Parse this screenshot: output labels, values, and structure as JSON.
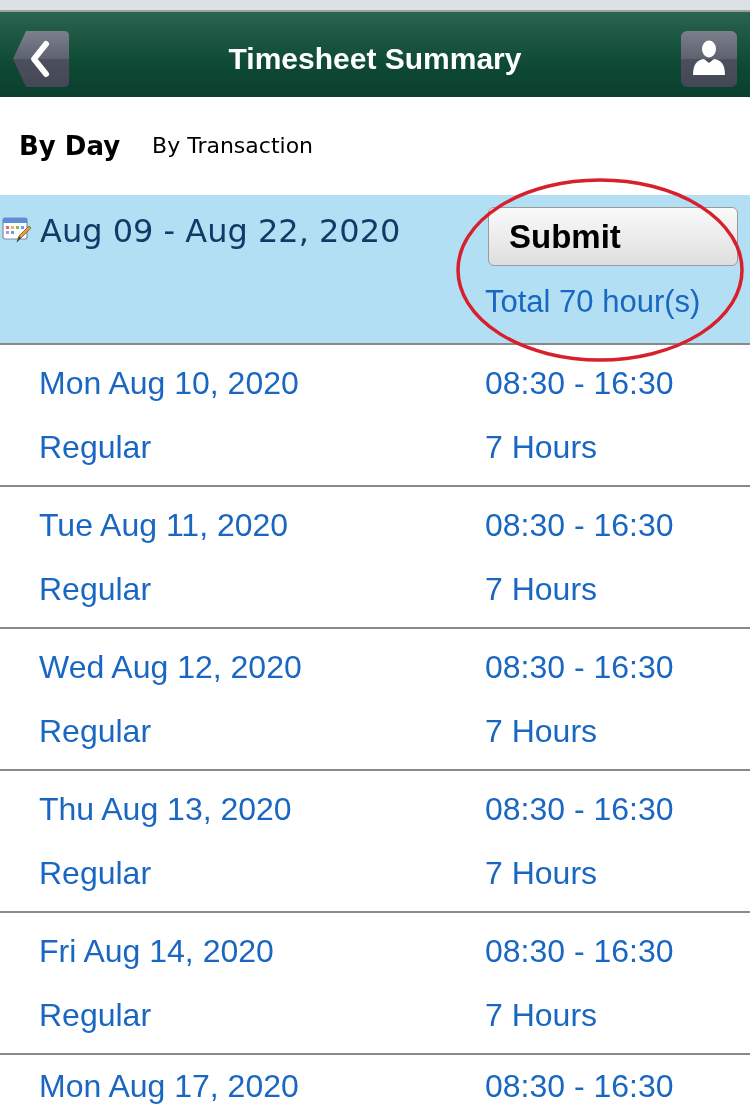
{
  "header": {
    "title": "Timesheet Summary"
  },
  "tabs": [
    {
      "label": "By Day",
      "selected": true
    },
    {
      "label": "By Transaction",
      "selected": false
    }
  ],
  "period": {
    "range": "Aug 09 - Aug 22, 2020",
    "submit_button": "Submit",
    "total": "Total 70 hour(s)"
  },
  "entries": [
    {
      "date": "Mon Aug 10, 2020",
      "time": "08:30 - 16:30",
      "type": "Regular",
      "hours": "7 Hours"
    },
    {
      "date": "Tue Aug 11, 2020",
      "time": "08:30 - 16:30",
      "type": "Regular",
      "hours": "7 Hours"
    },
    {
      "date": "Wed Aug 12, 2020",
      "time": "08:30 - 16:30",
      "type": "Regular",
      "hours": "7 Hours"
    },
    {
      "date": "Thu Aug 13, 2020",
      "time": "08:30 - 16:30",
      "type": "Regular",
      "hours": "7 Hours"
    },
    {
      "date": "Fri Aug 14, 2020",
      "time": "08:30 - 16:30",
      "type": "Regular",
      "hours": "7 Hours"
    },
    {
      "date": "Mon Aug 17, 2020",
      "time": "08:30 - 16:30"
    }
  ],
  "annotation": {
    "kind": "ellipse"
  }
}
